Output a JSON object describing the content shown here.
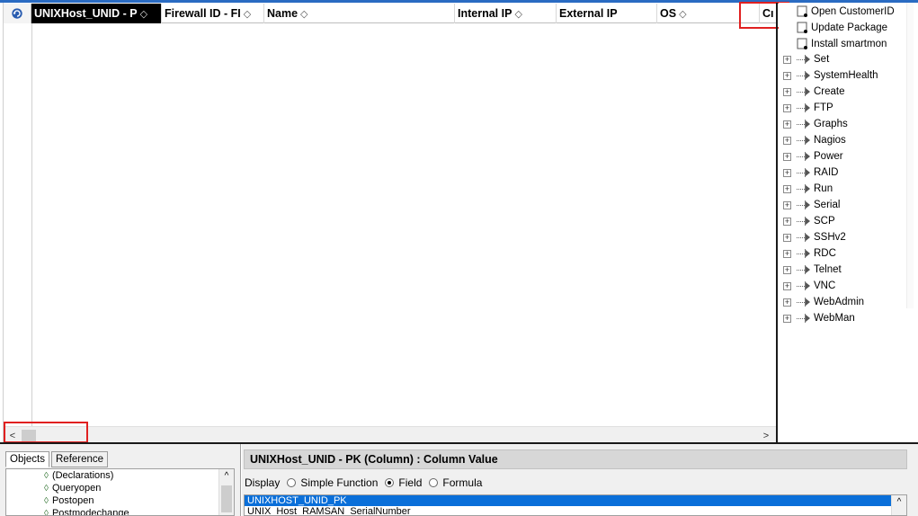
{
  "grid": {
    "columns": [
      {
        "label": "UNIXHost_UNID - P",
        "selected": true
      },
      {
        "label": "Firewall ID - FI",
        "selected": false
      },
      {
        "label": "Name",
        "selected": false
      },
      {
        "label": "Internal IP",
        "selected": false
      },
      {
        "label": "External IP",
        "selected": false
      },
      {
        "label": "OS",
        "selected": false
      },
      {
        "label": "Cı",
        "selected": false
      }
    ],
    "sort_glyph": "◇",
    "scroll_left": "<",
    "scroll_right": ">"
  },
  "actions": [
    {
      "label": "Open CustomerID",
      "icon": "document-key-icon"
    },
    {
      "label": "Update Package",
      "icon": "document-key-icon"
    },
    {
      "label": "Install smartmon",
      "icon": "document-key-icon"
    }
  ],
  "tree": {
    "expander": "+",
    "items": [
      "Set",
      "SystemHealth",
      "Create",
      "FTP",
      "Graphs",
      "Nagios",
      "Power",
      "RAID",
      "Run",
      "Serial",
      "SCP",
      "SSHv2",
      "RDC",
      "Telnet",
      "VNC",
      "WebAdmin",
      "WebMan"
    ]
  },
  "bottom_left": {
    "tabs": [
      "Objects",
      "Reference"
    ],
    "objects": [
      "(Declarations)",
      "Queryopen",
      "Postopen",
      "Postmodechange"
    ],
    "scroll_up": "^"
  },
  "bottom_right": {
    "title": "UNIXHost_UNID - PK (Column) : Column Value",
    "display_label": "Display",
    "options": [
      {
        "label": "Simple Function",
        "checked": false
      },
      {
        "label": "Field",
        "checked": true
      },
      {
        "label": "Formula",
        "checked": false
      }
    ],
    "fields": [
      "UNIXHOST_UNID_PK",
      "UNIX_Host_RAMSAN_SerialNumber"
    ],
    "scroll_up": "^"
  },
  "colors": {
    "accent": "#2a6bc2",
    "selection": "#0a6fd9",
    "highlight_box": "#e02020"
  }
}
